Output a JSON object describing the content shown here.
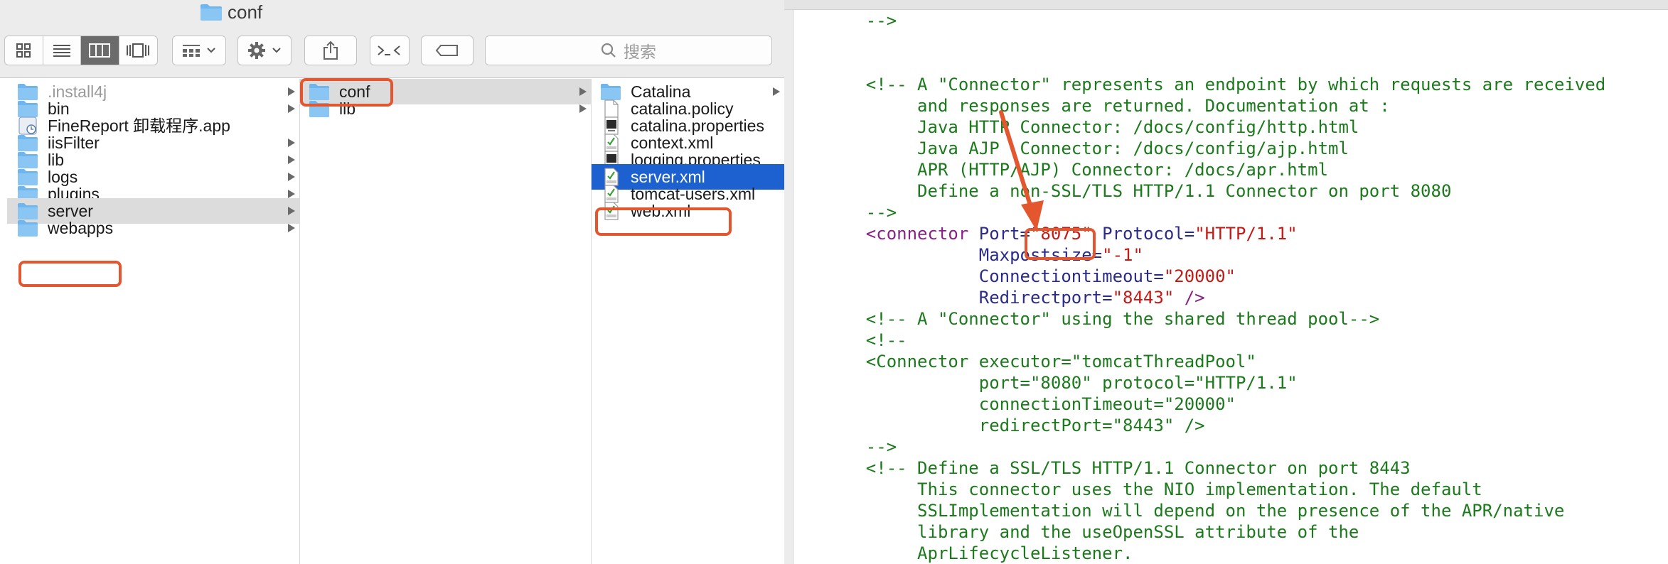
{
  "finder": {
    "title": "conf",
    "search_placeholder": "搜索",
    "toolbar": {
      "view_modes": [
        "icon-view",
        "list-view",
        "column-view",
        "cover-flow-view"
      ],
      "active_view": "column-view",
      "buttons": [
        "group-by",
        "action-gear",
        "share",
        "terminal",
        "tag"
      ]
    },
    "column1": [
      {
        "label": ".install4j",
        "dim": true,
        "arrow": true,
        "icon": "folder-icon"
      },
      {
        "label": "bin",
        "arrow": true,
        "icon": "folder-icon"
      },
      {
        "label": "FineReport 卸载程序.app",
        "arrow": false,
        "icon": "app-icon"
      },
      {
        "label": "iisFilter",
        "arrow": true,
        "icon": "folder-icon"
      },
      {
        "label": "lib",
        "arrow": true,
        "icon": "folder-icon"
      },
      {
        "label": "logs",
        "arrow": true,
        "icon": "folder-icon"
      },
      {
        "label": "plugins",
        "arrow": true,
        "icon": "folder-icon"
      },
      {
        "label": "server",
        "arrow": true,
        "icon": "folder-icon",
        "selected": true
      },
      {
        "label": "webapps",
        "arrow": true,
        "icon": "folder-icon"
      }
    ],
    "column2": [
      {
        "label": "conf",
        "arrow": true,
        "icon": "folder-icon",
        "selected": true
      },
      {
        "label": "lib",
        "arrow": true,
        "icon": "folder-icon"
      }
    ],
    "column3": [
      {
        "label": "Catalina",
        "arrow": true,
        "icon": "folder-icon"
      },
      {
        "label": "catalina.policy",
        "icon": "document-icon"
      },
      {
        "label": "catalina.properties",
        "icon": "exec-icon"
      },
      {
        "label": "context.xml",
        "icon": "xml-icon"
      },
      {
        "label": "logging.properties",
        "icon": "exec-icon"
      },
      {
        "label": "server.xml",
        "icon": "xml-icon",
        "selected": true
      },
      {
        "label": "tomcat-users.xml",
        "icon": "xml-icon"
      },
      {
        "label": "web.xml",
        "icon": "xml-icon"
      }
    ]
  },
  "editor": {
    "lines": [
      [
        [
          "c-comment",
          "    -->"
        ]
      ],
      [
        [
          "c-plain",
          ""
        ]
      ],
      [
        [
          "c-plain",
          ""
        ]
      ],
      [
        [
          "c-comment",
          "    <!-- A \"Connector\" represents an endpoint by which requests are received"
        ]
      ],
      [
        [
          "c-comment",
          "         and responses are returned. Documentation at :"
        ]
      ],
      [
        [
          "c-comment",
          "         Java HTTP Connector: /docs/config/http.html"
        ]
      ],
      [
        [
          "c-comment",
          "         Java AJP  Connector: /docs/config/ajp.html"
        ]
      ],
      [
        [
          "c-comment",
          "         APR (HTTP/AJP) Connector: /docs/apr.html"
        ]
      ],
      [
        [
          "c-comment",
          "         Define a non-SSL/TLS HTTP/1.1 Connector on port 8080"
        ]
      ],
      [
        [
          "c-comment",
          "    -->"
        ]
      ],
      [
        [
          "c-tag",
          "    <connector "
        ],
        [
          "c-attr",
          "Port="
        ],
        [
          "c-str",
          "\"8075\""
        ],
        [
          "c-attr",
          " Protocol="
        ],
        [
          "c-str",
          "\"HTTP/1.1\""
        ]
      ],
      [
        [
          "c-attr",
          "               Maxpostsize="
        ],
        [
          "c-str",
          "\"-1\""
        ]
      ],
      [
        [
          "c-attr",
          "               Connectiontimeout="
        ],
        [
          "c-str",
          "\"20000\""
        ]
      ],
      [
        [
          "c-attr",
          "               Redirectport="
        ],
        [
          "c-str",
          "\"8443\""
        ],
        [
          "c-tag",
          " />"
        ]
      ],
      [
        [
          "c-comment",
          "    <!-- A \"Connector\" using the shared thread pool-->"
        ]
      ],
      [
        [
          "c-comment",
          "    <!--"
        ]
      ],
      [
        [
          "c-comment",
          "    <Connector executor=\"tomcatThreadPool\""
        ]
      ],
      [
        [
          "c-comment",
          "               port=\"8080\" protocol=\"HTTP/1.1\""
        ]
      ],
      [
        [
          "c-comment",
          "               connectionTimeout=\"20000\""
        ]
      ],
      [
        [
          "c-comment",
          "               redirectPort=\"8443\" />"
        ]
      ],
      [
        [
          "c-comment",
          "    -->"
        ]
      ],
      [
        [
          "c-comment",
          "    <!-- Define a SSL/TLS HTTP/1.1 Connector on port 8443"
        ]
      ],
      [
        [
          "c-comment",
          "         This connector uses the NIO implementation. The default"
        ]
      ],
      [
        [
          "c-comment",
          "         SSLImplementation will depend on the presence of the APR/native"
        ]
      ],
      [
        [
          "c-comment",
          "         library and the useOpenSSL attribute of the"
        ]
      ],
      [
        [
          "c-comment",
          "         AprLifecycleListener."
        ]
      ]
    ]
  },
  "colors": {
    "highlight": "#e4572e",
    "selection_blue": "#1d61d1",
    "selection_gray": "#dcdcdc",
    "folder": "#6fb6ee"
  }
}
